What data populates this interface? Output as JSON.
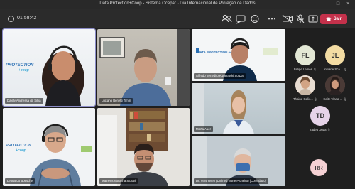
{
  "window": {
    "title": "Data Protection+Coop - Sistema Ocepar - Dia Internacional de Proteção de Dados"
  },
  "toolbar": {
    "timer": "01:58:42",
    "leave_label": "Sair"
  },
  "tiles": {
    "t1": {
      "name": "Daiely Andressa da Silva",
      "logo": "PROTECTION",
      "logo2": "+coop"
    },
    "t2": {
      "name": "Luciano Benetti Timm"
    },
    "t3": {
      "name": "Alfredo Benedito Kugeratski Souza",
      "logo": "DATA PROTECTION +coop"
    },
    "t4": {
      "name": "Marta Auer"
    },
    "t5": {
      "name": "Leonardo Boesche",
      "logo": "PROTECTION",
      "logo2": "+coop"
    },
    "t6": {
      "name": "Matheus Noronha Sturari"
    },
    "t7": {
      "name": "Dr. Vershoven (Unimed Norte Pioneiro) (Convidado)"
    }
  },
  "participants": [
    {
      "initials": "FL",
      "name": "Felipe Lemes",
      "color": "#e3e8d5"
    },
    {
      "initials": "JL",
      "name": "Josiane Sca...",
      "color": "#f3dca3"
    },
    {
      "initials": "",
      "name": "Thaine Galic...",
      "color": "#b88c77"
    },
    {
      "initials": "",
      "name": "Edite Viana ...",
      "color": "#6a5049"
    },
    {
      "initials": "TD",
      "name": "Tadeu Duda",
      "color": "#e6d3e8"
    },
    {
      "initials": "RR",
      "name": "",
      "color": "#f5d1d4"
    }
  ]
}
